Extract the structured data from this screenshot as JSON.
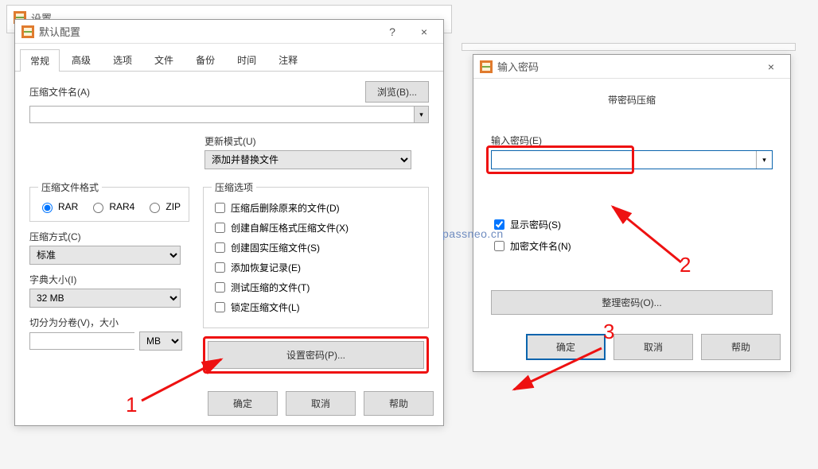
{
  "background_window_title": "设置",
  "watermark": "passneo.cn",
  "default_dialog": {
    "title": "默认配置",
    "help_icon": "?",
    "close_icon": "×",
    "tabs": [
      "常规",
      "高级",
      "选项",
      "文件",
      "备份",
      "时间",
      "注释"
    ],
    "active_tab": 0,
    "filename_label": "压缩文件名(A)",
    "filename_value": "",
    "browse_label": "浏览(B)...",
    "update_mode_label": "更新模式(U)",
    "update_mode_value": "添加并替换文件",
    "format_legend": "压缩文件格式",
    "formats": [
      "RAR",
      "RAR4",
      "ZIP"
    ],
    "format_selected": "RAR",
    "options_legend": "压缩选项",
    "options": [
      "压缩后删除原来的文件(D)",
      "创建自解压格式压缩文件(X)",
      "创建固实压缩文件(S)",
      "添加恢复记录(E)",
      "测试压缩的文件(T)",
      "锁定压缩文件(L)"
    ],
    "method_label": "压缩方式(C)",
    "method_value": "标准",
    "dict_label": "字典大小(I)",
    "dict_value": "32 MB",
    "split_label": "切分为分卷(V)，大小",
    "split_value": "",
    "split_unit": "MB",
    "set_password_label": "设置密码(P)...",
    "btn_ok": "确定",
    "btn_cancel": "取消",
    "btn_help": "帮助"
  },
  "password_dialog": {
    "title": "输入密码",
    "close_icon": "×",
    "heading": "带密码压缩",
    "password_label": "输入密码(E)",
    "password_value": "",
    "show_password_label": "显示密码(S)",
    "show_password_checked": true,
    "encrypt_names_label": "加密文件名(N)",
    "encrypt_names_checked": false,
    "organize_label": "整理密码(O)...",
    "btn_ok": "确定",
    "btn_cancel": "取消",
    "btn_help": "帮助"
  },
  "annotations": {
    "n1": "1",
    "n2": "2",
    "n3": "3"
  }
}
